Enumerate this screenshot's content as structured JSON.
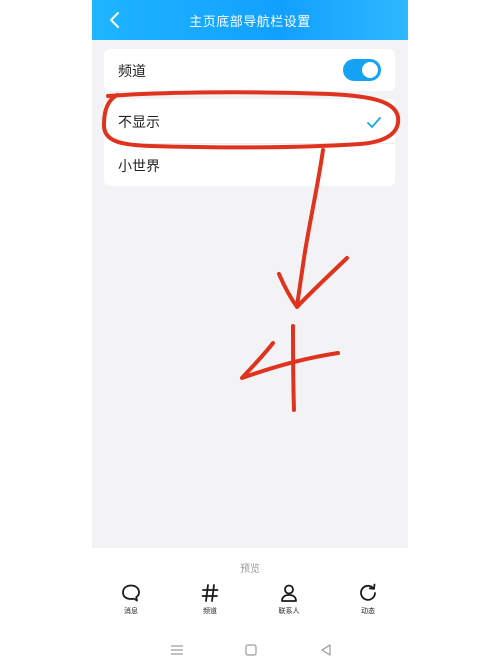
{
  "header": {
    "title": "主页底部导航栏设置",
    "back_icon": "chevron-left-icon"
  },
  "settings": {
    "channel": {
      "label": "频道",
      "toggle_on": true
    },
    "options": [
      {
        "label": "不显示",
        "selected": true
      },
      {
        "label": "小世界",
        "selected": false
      }
    ]
  },
  "preview": {
    "label": "预览",
    "nav_items": [
      {
        "label": "消息",
        "icon": "message-bubble-icon"
      },
      {
        "label": "频道",
        "icon": "hash-icon"
      },
      {
        "label": "联系人",
        "icon": "contact-person-icon"
      },
      {
        "label": "动态",
        "icon": "refresh-icon"
      }
    ]
  },
  "system_nav": {
    "icons": [
      "menu-icon",
      "home-square-icon",
      "back-triangle-icon"
    ]
  },
  "colors": {
    "titlebar": "#12a0ff",
    "toggle": "#14a2f5",
    "check": "#1ea7e0",
    "annotation": "#e0331f"
  },
  "annotation": {
    "text": "4"
  }
}
